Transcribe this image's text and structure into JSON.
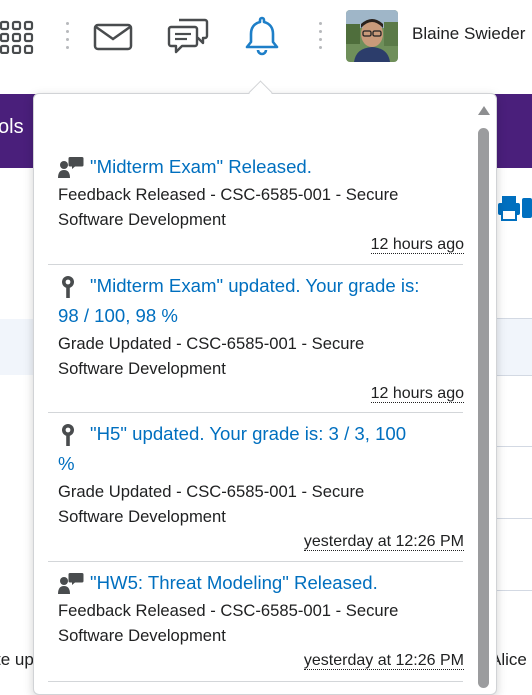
{
  "navbar": {
    "icons": [
      "grid-icon",
      "mail-icon",
      "chat-icon",
      "bell-icon"
    ],
    "user_name": "Blaine Swieder",
    "accent_color": "#1e7fc8"
  },
  "page": {
    "tab_fragment": "ols",
    "bottom_left_fragment": "te up",
    "bottom_right_fragment": "Alice"
  },
  "notifications": [
    {
      "icon": "feedback-icon",
      "title": "\"Midterm Exam\" Released.",
      "desc_line1": "Feedback Released - CSC-6585-001 - Secure",
      "desc_line2": "Software Development",
      "time": "12 hours ago"
    },
    {
      "icon": "grade-pin-icon",
      "title_line1": "\"Midterm Exam\" updated. Your grade is:",
      "title_line2": "98 / 100, 98 %",
      "desc_line1": "Grade Updated - CSC-6585-001 - Secure",
      "desc_line2": "Software Development",
      "time": "12 hours ago"
    },
    {
      "icon": "grade-pin-icon",
      "title_line1": "\"H5\" updated. Your grade is: 3 / 3, 100",
      "title_line2": "%",
      "desc_line1": "Grade Updated - CSC-6585-001 - Secure",
      "desc_line2": "Software Development",
      "time": "yesterday at 12:26 PM"
    },
    {
      "icon": "feedback-icon",
      "title": "\"HW5: Threat Modeling\" Released.",
      "desc_line1": "Feedback Released - CSC-6585-001 - Secure",
      "desc_line2": "Software Development",
      "time": "yesterday at 12:26 PM"
    }
  ],
  "colors": {
    "link": "#006fbf",
    "purple": "#4a1f7b",
    "text": "#202122"
  }
}
